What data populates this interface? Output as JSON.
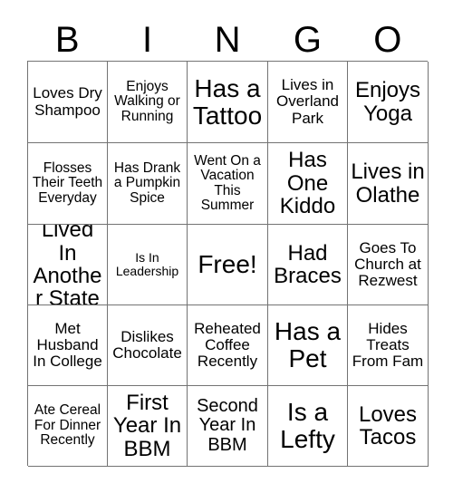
{
  "card": {
    "title_letters": [
      "B",
      "I",
      "N",
      "G",
      "O"
    ],
    "rows": [
      [
        {
          "text": "Loves Dry Shampoo",
          "size": "m"
        },
        {
          "text": "Enjoys Walking or Running",
          "size": "s"
        },
        {
          "text": "Has a Tattoo",
          "size": "xxl"
        },
        {
          "text": "Lives in Overland Park",
          "size": "m"
        },
        {
          "text": "Enjoys Yoga",
          "size": "xl"
        }
      ],
      [
        {
          "text": "Flosses Their Teeth Everyday",
          "size": "s"
        },
        {
          "text": "Has Drank a Pumpkin Spice",
          "size": "s"
        },
        {
          "text": "Went On a Vacation This Summer",
          "size": "s"
        },
        {
          "text": "Has One Kiddo",
          "size": "xl"
        },
        {
          "text": "Lives in Olathe",
          "size": "xl"
        }
      ],
      [
        {
          "text": "Lived In Another State",
          "size": "xl"
        },
        {
          "text": "Is In Leadership",
          "size": "xs"
        },
        {
          "text": "Free!",
          "size": "xxl"
        },
        {
          "text": "Had Braces",
          "size": "xl"
        },
        {
          "text": "Goes To Church at Rezwest",
          "size": "m"
        }
      ],
      [
        {
          "text": "Met Husband In College",
          "size": "m"
        },
        {
          "text": "Dislikes Chocolate",
          "size": "m"
        },
        {
          "text": "Reheated Coffee Recently",
          "size": "m"
        },
        {
          "text": "Has a Pet",
          "size": "xxl"
        },
        {
          "text": "Hides Treats From Fam",
          "size": "m"
        }
      ],
      [
        {
          "text": "Ate Cereal For Dinner Recently",
          "size": "s"
        },
        {
          "text": "First Year In BBM",
          "size": "xl"
        },
        {
          "text": "Second Year In BBM",
          "size": "l"
        },
        {
          "text": "Is a Lefty",
          "size": "xxl"
        },
        {
          "text": "Loves Tacos",
          "size": "xl"
        }
      ]
    ]
  },
  "colors": {
    "background": "#ffffff",
    "text": "#000000",
    "grid_line": "#737373"
  }
}
